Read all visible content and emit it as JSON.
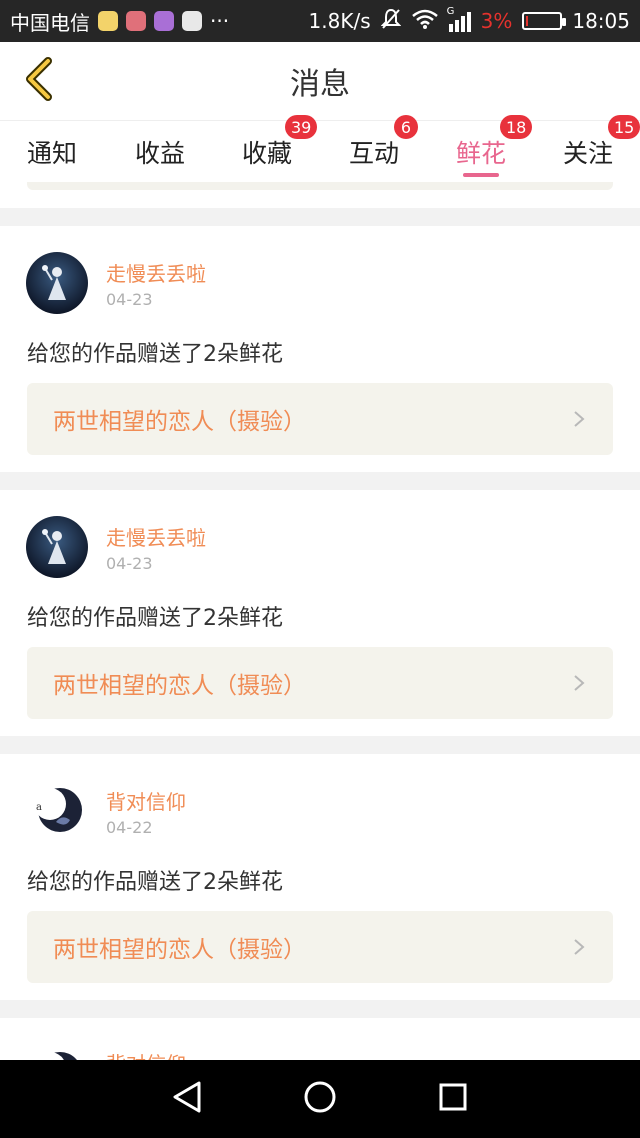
{
  "status_bar": {
    "carrier": "中国电信",
    "dots": "···",
    "network_speed": "1.8K/s",
    "battery_percent": "3%",
    "time": "18:05",
    "net_type": "G"
  },
  "header": {
    "title": "消息",
    "back_icon": "chevron-left-icon"
  },
  "tabs": [
    {
      "label": "通知",
      "badge": ""
    },
    {
      "label": "收益",
      "badge": ""
    },
    {
      "label": "收藏",
      "badge": "39"
    },
    {
      "label": "互动",
      "badge": "6"
    },
    {
      "label": "鲜花",
      "badge": "18",
      "active": true
    },
    {
      "label": "关注",
      "badge": "15"
    }
  ],
  "messages": [
    {
      "username": "走慢丢丢啦",
      "date": "04-23",
      "text": "给您的作品赠送了2朵鲜花",
      "work_title": "两世相望的恋人（摄验）"
    },
    {
      "username": "走慢丢丢啦",
      "date": "04-23",
      "text": "给您的作品赠送了2朵鲜花",
      "work_title": "两世相望的恋人（摄验）"
    },
    {
      "username": "背对信仰",
      "date": "04-22",
      "text": "给您的作品赠送了2朵鲜花",
      "work_title": "两世相望的恋人（摄验）"
    }
  ],
  "partial_next": {
    "username": "背对信仰"
  },
  "colors": {
    "accent_pink": "#e8668e",
    "badge_red": "#e8323c",
    "username_orange": "#f08c55"
  }
}
